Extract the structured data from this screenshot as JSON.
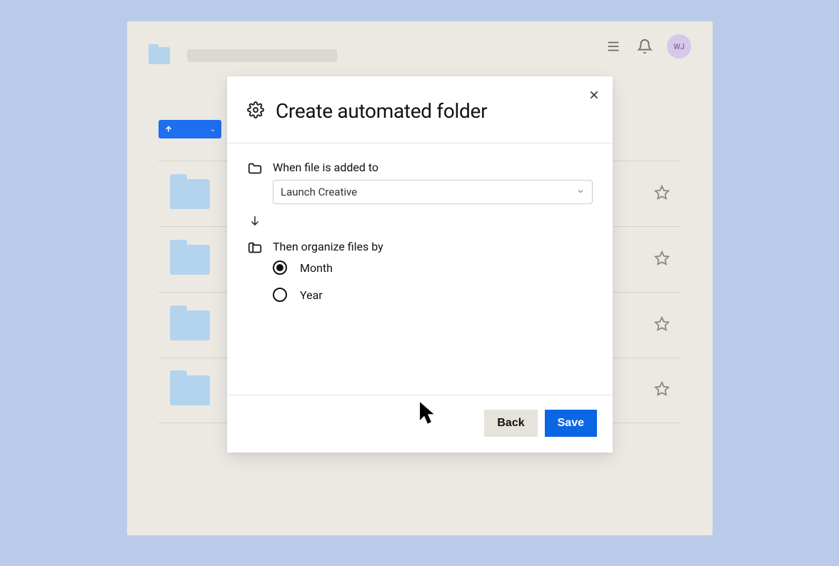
{
  "header": {
    "avatar_initials": "WJ"
  },
  "modal": {
    "title": "Create automated folder",
    "when_label": "When file is added to",
    "folder_selected": "Launch Creative",
    "then_label": "Then organize files by",
    "options": {
      "month": "Month",
      "year": "Year"
    },
    "selected_option": "month",
    "back_label": "Back",
    "save_label": "Save"
  }
}
